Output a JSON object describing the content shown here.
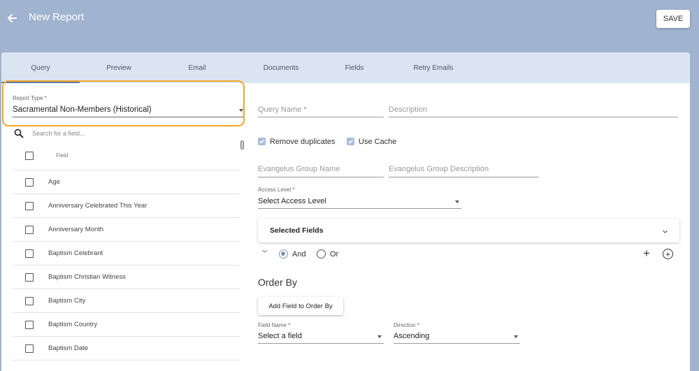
{
  "header": {
    "title": "New Report",
    "save_label": "SAVE"
  },
  "tabs": [
    {
      "label": "Query",
      "active": true
    },
    {
      "label": "Preview",
      "active": false
    },
    {
      "label": "Email",
      "active": false
    },
    {
      "label": "Documents",
      "active": false
    },
    {
      "label": "Fields",
      "active": false
    },
    {
      "label": "Retry Emails",
      "active": false
    }
  ],
  "report_type": {
    "label": "Report Type *",
    "value": "Sacramental Non-Members (Historical)"
  },
  "field_search": {
    "placeholder": "Search for a field..."
  },
  "field_list": {
    "header": "Field",
    "items": [
      "Age",
      "Anniversary Celebrated This Year",
      "Anniversary Month",
      "Baptism Celebrant",
      "Baptism Christian Witness",
      "Baptism City",
      "Baptism Country",
      "Baptism Date"
    ]
  },
  "query": {
    "name_placeholder": "Query Name *",
    "description_placeholder": "Description",
    "remove_duplicates": {
      "label": "Remove duplicates",
      "checked": true
    },
    "use_cache": {
      "label": "Use Cache",
      "checked": true
    },
    "group_name_placeholder": "Evangelus Group Name",
    "group_description_placeholder": "Evangelus Group Description",
    "access_level": {
      "label": "Access Level *",
      "value": "Select Access Level"
    }
  },
  "selected_fields": {
    "title": "Selected Fields",
    "logic": {
      "and_label": "And",
      "or_label": "Or",
      "selected": "And"
    }
  },
  "order_by": {
    "title": "Order By",
    "add_button": "Add Field to Order By",
    "field_name": {
      "label": "Field Name *",
      "value": "Select a field"
    },
    "direction": {
      "label": "Direction *",
      "value": "Ascending"
    }
  },
  "colors": {
    "header_bg": "#a0b3cf",
    "tab_bg": "#dbe5f1",
    "highlight": "#f2a629",
    "accent": "#7f93b4"
  }
}
